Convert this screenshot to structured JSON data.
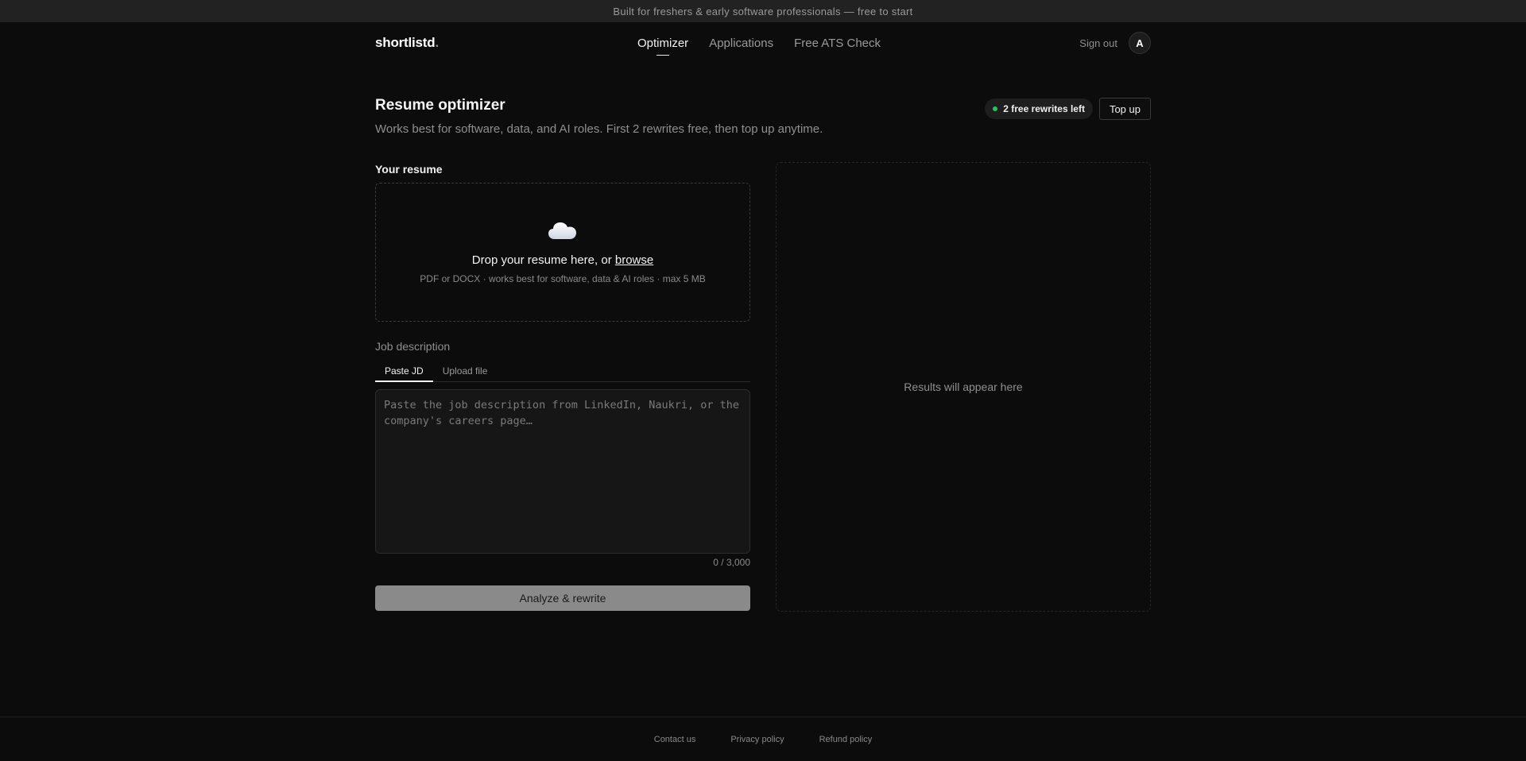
{
  "banner": {
    "text": "Built for freshers & early software professionals — free to start"
  },
  "nav": {
    "logo": "shortlistd",
    "logo_dot": ".",
    "links": [
      {
        "label": "Optimizer",
        "active": true
      },
      {
        "label": "Applications",
        "active": false
      },
      {
        "label": "Free ATS Check",
        "active": false
      }
    ],
    "sign_out": "Sign out",
    "avatar_initial": "A"
  },
  "header": {
    "title": "Resume optimizer",
    "subtitle": "Works best for software, data, and AI roles. First 2 rewrites free, then top up anytime.",
    "credits_label": "2 free rewrites left",
    "topup_label": "Top up"
  },
  "resume": {
    "label": "Your resume",
    "cloud_icon": "cloud-icon",
    "drop_text": "Drop your resume here, or ",
    "browse_label": "browse",
    "hint": "PDF or DOCX · works best for software, data & AI roles · max 5 MB"
  },
  "jd": {
    "label": "Job description",
    "tabs": [
      {
        "label": "Paste JD",
        "active": true
      },
      {
        "label": "Upload file",
        "active": false
      }
    ],
    "value": "",
    "placeholder": "Paste the job description from LinkedIn, Naukri, or the company's careers page…",
    "char_count": "0 / 3,000"
  },
  "analyze_label": "Analyze & rewrite",
  "results": {
    "empty_text": "Results will appear here"
  },
  "footer": {
    "links": [
      "Contact us",
      "Privacy policy",
      "Refund policy"
    ]
  },
  "colors": {
    "background": "#0c0c0c",
    "banner": "#222222",
    "accent_green": "#22c55e",
    "button_disabled": "#8a8a8a"
  }
}
